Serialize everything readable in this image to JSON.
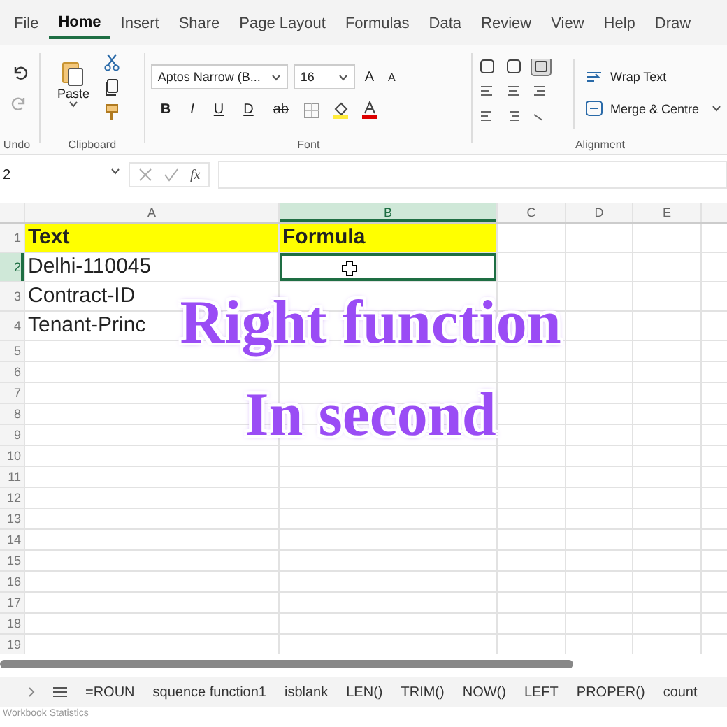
{
  "tabs": [
    {
      "label": "File",
      "selected": false
    },
    {
      "label": "Home",
      "selected": true
    },
    {
      "label": "Insert",
      "selected": false
    },
    {
      "label": "Share",
      "selected": false
    },
    {
      "label": "Page Layout",
      "selected": false
    },
    {
      "label": "Formulas",
      "selected": false
    },
    {
      "label": "Data",
      "selected": false
    },
    {
      "label": "Review",
      "selected": false
    },
    {
      "label": "View",
      "selected": false
    },
    {
      "label": "Help",
      "selected": false
    },
    {
      "label": "Draw",
      "selected": false
    }
  ],
  "ribbon": {
    "undo_label": "Undo",
    "paste_label": "Paste",
    "clipboard_label": "Clipboard",
    "font_name": "Aptos Narrow (B...",
    "font_size": "16",
    "grow_label": "A",
    "shrink_label": "A",
    "format_buttons": [
      "B",
      "I",
      "U",
      "D",
      "ab"
    ],
    "font_label": "Font",
    "wrap_text": "Wrap Text",
    "merge_centre": "Merge & Centre",
    "alignment_label": "Alignment"
  },
  "formula_bar": {
    "name_box": "2",
    "fx": "fx"
  },
  "columns": [
    {
      "label": "A",
      "selected": false
    },
    {
      "label": "B",
      "selected": true
    },
    {
      "label": "C",
      "selected": false
    },
    {
      "label": "D",
      "selected": false
    },
    {
      "label": "E",
      "selected": false
    }
  ],
  "rows": [
    {
      "label": "1",
      "selected": false,
      "kind": "header",
      "cells": [
        "Text",
        "Formula"
      ]
    },
    {
      "label": "2",
      "selected": true,
      "kind": "data",
      "cells": [
        "Delhi-110045",
        ""
      ]
    },
    {
      "label": "3",
      "selected": false,
      "kind": "data",
      "cells": [
        "Contract-ID",
        ""
      ]
    },
    {
      "label": "4",
      "selected": false,
      "kind": "data",
      "cells": [
        "Tenant-Princ",
        ""
      ]
    },
    {
      "label": "5",
      "selected": false,
      "kind": "empty",
      "cells": []
    },
    {
      "label": "6",
      "selected": false,
      "kind": "empty",
      "cells": []
    },
    {
      "label": "7",
      "selected": false,
      "kind": "empty",
      "cells": []
    },
    {
      "label": "8",
      "selected": false,
      "kind": "empty",
      "cells": []
    },
    {
      "label": "9",
      "selected": false,
      "kind": "empty",
      "cells": []
    },
    {
      "label": "10",
      "selected": false,
      "kind": "empty",
      "cells": []
    },
    {
      "label": "11",
      "selected": false,
      "kind": "empty",
      "cells": []
    },
    {
      "label": "12",
      "selected": false,
      "kind": "empty",
      "cells": []
    },
    {
      "label": "13",
      "selected": false,
      "kind": "empty",
      "cells": []
    },
    {
      "label": "14",
      "selected": false,
      "kind": "empty",
      "cells": []
    },
    {
      "label": "15",
      "selected": false,
      "kind": "empty",
      "cells": []
    },
    {
      "label": "16",
      "selected": false,
      "kind": "empty",
      "cells": []
    },
    {
      "label": "17",
      "selected": false,
      "kind": "empty",
      "cells": []
    },
    {
      "label": "18",
      "selected": false,
      "kind": "empty",
      "cells": []
    },
    {
      "label": "19",
      "selected": false,
      "kind": "empty",
      "cells": []
    }
  ],
  "caption": [
    "Right function",
    "In second"
  ],
  "sheet_tabs": [
    "=ROUN",
    "squence function1",
    "isblank",
    "LEN()",
    "TRIM()",
    "NOW()",
    "LEFT",
    "PROPER()",
    "count"
  ],
  "status_bar": "Workbook Statistics"
}
